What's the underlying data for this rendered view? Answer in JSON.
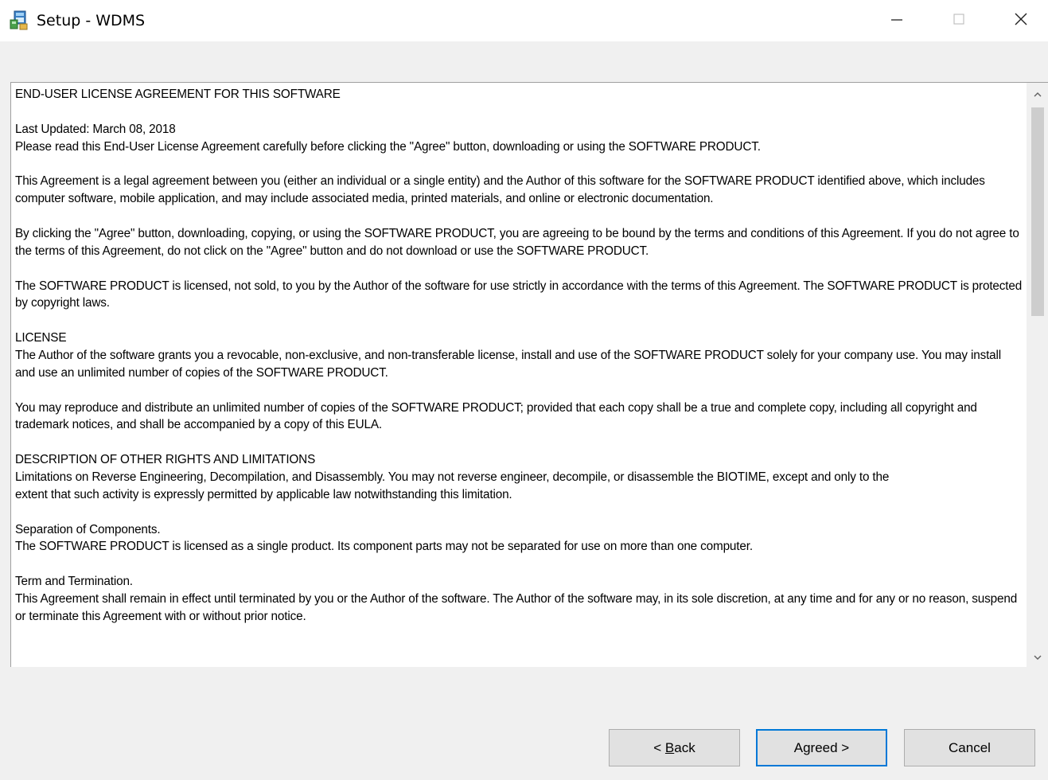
{
  "window": {
    "title": "Setup - WDMS",
    "icon": "installer-icon",
    "controls": {
      "minimize_icon": "minimize-icon",
      "maximize_icon": "maximize-icon",
      "close_icon": "close-icon"
    }
  },
  "license": {
    "paragraphs": [
      "END-USER LICENSE AGREEMENT FOR THIS SOFTWARE",
      "Last Updated: March 08, 2018\nPlease read this End-User License Agreement carefully before clicking the \"Agree\" button, downloading or using the SOFTWARE PRODUCT.",
      "This Agreement is a legal agreement between you (either an individual or a single entity) and the Author of this software for the SOFTWARE PRODUCT identified above, which includes computer software, mobile application, and may include associated media, printed materials, and online or electronic documentation.",
      "By clicking the \"Agree\" button, downloading, copying, or using the SOFTWARE PRODUCT, you are agreeing to be bound by the terms and conditions of this Agreement. If you do not agree to the terms of this Agreement, do not click on the \"Agree\" button and do not download or use the SOFTWARE PRODUCT.",
      "The SOFTWARE PRODUCT is licensed, not sold, to you by the Author of the software for use strictly in accordance with the terms of this Agreement. The SOFTWARE PRODUCT is protected by copyright laws.",
      "LICENSE\nThe Author of the software grants you a revocable, non-exclusive, and non-transferable license,  install and use of the SOFTWARE PRODUCT solely for your company use. You may install and use an unlimited number of copies of the SOFTWARE PRODUCT.",
      "You may reproduce and distribute an unlimited number of copies of the SOFTWARE PRODUCT; provided that each copy shall be a true and complete copy, including all copyright and trademark notices, and shall be accompanied by a copy of this EULA.",
      "DESCRIPTION OF OTHER RIGHTS AND LIMITATIONS\nLimitations on Reverse Engineering, Decompilation, and Disassembly. You may not reverse engineer, decompile, or disassemble the BIOTIME, except and only to the\nextent that such activity is expressly permitted by applicable law notwithstanding this limitation.",
      "Separation of Components.\nThe SOFTWARE PRODUCT is licensed as a single product. Its component parts may not be separated for use on more than one computer.",
      "Term and Termination.\nThis Agreement shall remain in effect until terminated by you or the Author of the software. The Author of the software may, in its sole discretion, at any time and for any or no reason, suspend or terminate this Agreement with or without prior notice."
    ]
  },
  "buttons": {
    "back_pre": "< ",
    "back_accel": "B",
    "back_post": "ack",
    "agreed": "Agreed >",
    "cancel": "Cancel"
  }
}
